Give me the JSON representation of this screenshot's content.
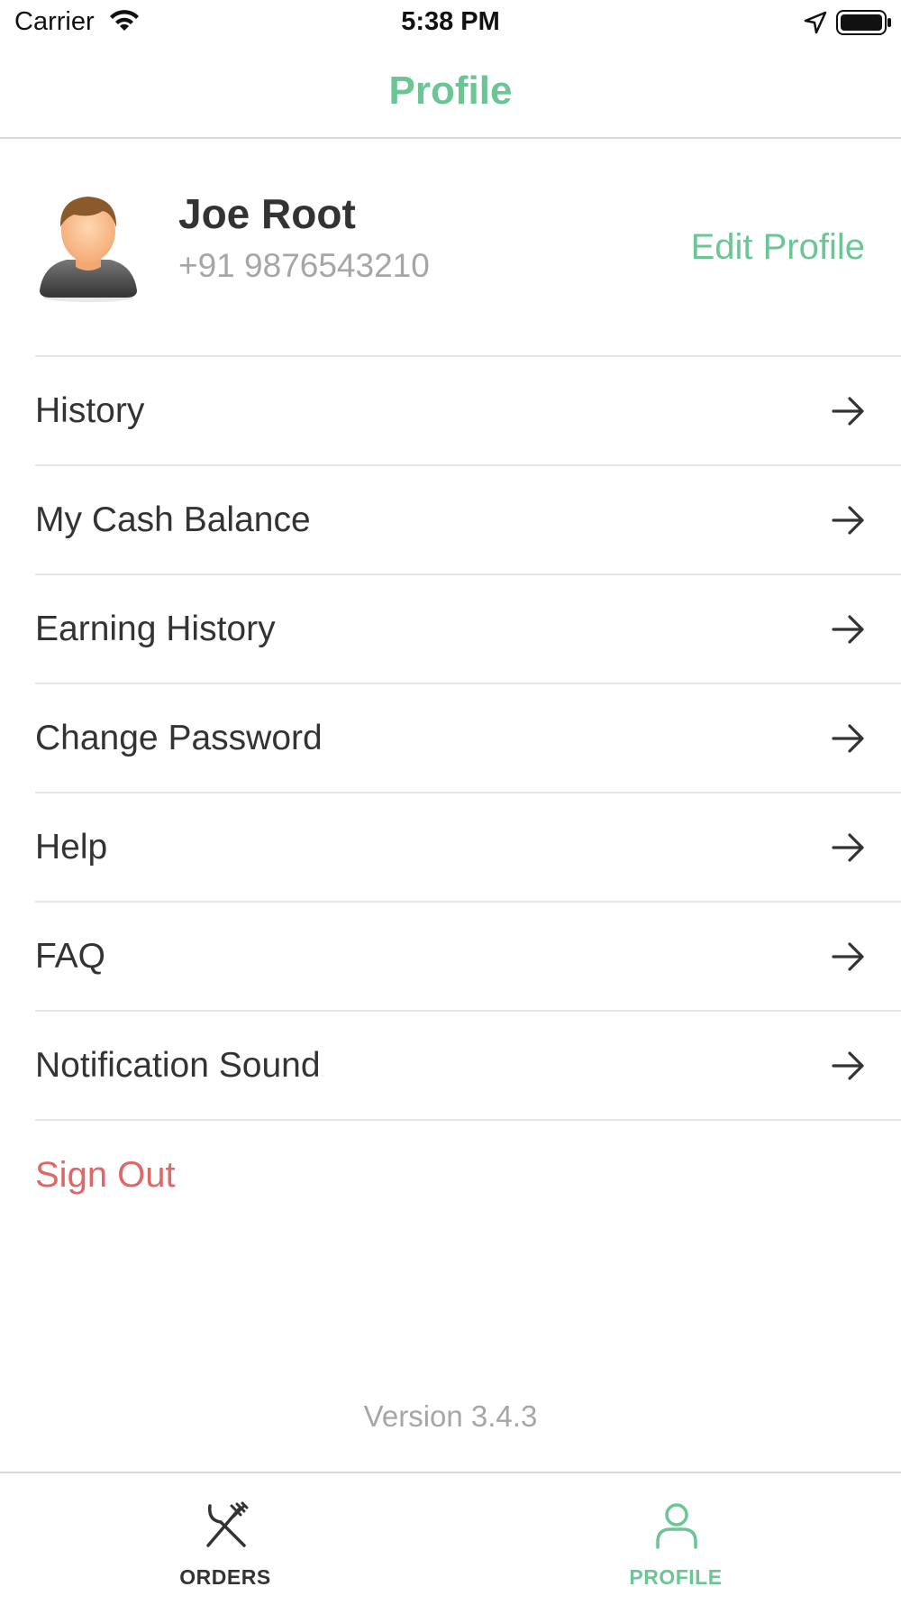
{
  "status_bar": {
    "carrier": "Carrier",
    "time": "5:38 PM"
  },
  "header": {
    "title": "Profile"
  },
  "profile": {
    "name": "Joe Root",
    "phone": "+91 9876543210",
    "edit_label": "Edit Profile"
  },
  "menu": {
    "items": [
      {
        "label": "History"
      },
      {
        "label": "My Cash Balance"
      },
      {
        "label": "Earning History"
      },
      {
        "label": "Change Password"
      },
      {
        "label": "Help"
      },
      {
        "label": "FAQ"
      },
      {
        "label": "Notification Sound"
      }
    ],
    "sign_out_label": "Sign Out"
  },
  "version": "Version 3.4.3",
  "tab_bar": {
    "tabs": [
      {
        "label": "ORDERS",
        "icon": "fork-knife-icon",
        "active": false
      },
      {
        "label": "PROFILE",
        "icon": "person-icon",
        "active": true
      }
    ]
  },
  "colors": {
    "accent": "#6cc595",
    "danger": "#e06766",
    "muted": "#a6a6a6",
    "text": "#333333"
  }
}
